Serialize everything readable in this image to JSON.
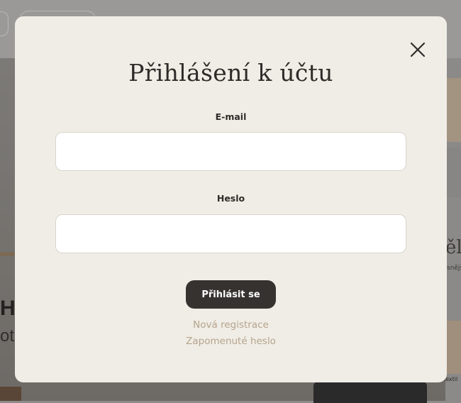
{
  "background": {
    "left_heading": "H",
    "left_subtext": "ot",
    "right_heading": "ěl",
    "right_subtext": "snějš",
    "right_caption": "textil"
  },
  "modal": {
    "title": "Přihlášení k účtu",
    "close_icon": "close-icon",
    "email": {
      "label": "E-mail",
      "value": "",
      "placeholder": ""
    },
    "password": {
      "label": "Heslo",
      "value": "",
      "placeholder": ""
    },
    "submit_label": "Přihlásit se",
    "register_link": "Nová registrace",
    "forgot_link": "Zapomenuté heslo"
  },
  "colors": {
    "modal_bg": "#f0ede6",
    "button_bg": "#363230",
    "link_color": "#b5a48d",
    "overlay": "#8d8c8a"
  }
}
